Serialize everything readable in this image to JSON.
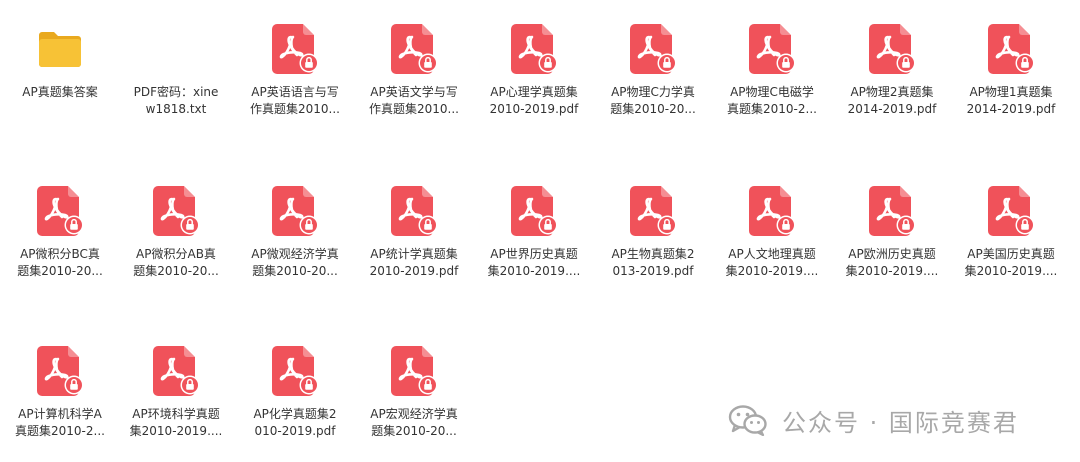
{
  "colors": {
    "pdf_icon": "#f0525a",
    "folder_icon": "#f7c236",
    "label_text": "#333333",
    "watermark": "#9a9a9a"
  },
  "files": [
    {
      "type": "folder",
      "icon": "folder-icon",
      "line1": "AP真题集答案",
      "line2": ""
    },
    {
      "type": "txt",
      "icon": "",
      "line1": "PDF密码：xine",
      "line2": "w1818.txt"
    },
    {
      "type": "pdf",
      "icon": "pdf-icon",
      "line1": "AP英语语言与写",
      "line2": "作真题集2010..."
    },
    {
      "type": "pdf",
      "icon": "pdf-icon",
      "line1": "AP英语文学与写",
      "line2": "作真题集2010..."
    },
    {
      "type": "pdf",
      "icon": "pdf-icon",
      "line1": "AP心理学真题集",
      "line2": "2010-2019.pdf"
    },
    {
      "type": "pdf",
      "icon": "pdf-icon",
      "line1": "AP物理C力学真",
      "line2": "题集2010-20..."
    },
    {
      "type": "pdf",
      "icon": "pdf-icon",
      "line1": "AP物理C电磁学",
      "line2": "真题集2010-2..."
    },
    {
      "type": "pdf",
      "icon": "pdf-icon",
      "line1": "AP物理2真题集",
      "line2": "2014-2019.pdf"
    },
    {
      "type": "pdf",
      "icon": "pdf-icon",
      "line1": "AP物理1真题集",
      "line2": "2014-2019.pdf"
    },
    {
      "type": "pdf",
      "icon": "pdf-icon",
      "line1": "AP微积分BC真",
      "line2": "题集2010-20..."
    },
    {
      "type": "pdf",
      "icon": "pdf-icon",
      "line1": "AP微积分AB真",
      "line2": "题集2010-20..."
    },
    {
      "type": "pdf",
      "icon": "pdf-icon",
      "line1": "AP微观经济学真",
      "line2": "题集2010-20..."
    },
    {
      "type": "pdf",
      "icon": "pdf-icon",
      "line1": "AP统计学真题集",
      "line2": "2010-2019.pdf"
    },
    {
      "type": "pdf",
      "icon": "pdf-icon",
      "line1": "AP世界历史真题",
      "line2": "集2010-2019...."
    },
    {
      "type": "pdf",
      "icon": "pdf-icon",
      "line1": "AP生物真题集2",
      "line2": "013-2019.pdf"
    },
    {
      "type": "pdf",
      "icon": "pdf-icon",
      "line1": "AP人文地理真题",
      "line2": "集2010-2019...."
    },
    {
      "type": "pdf",
      "icon": "pdf-icon",
      "line1": "AP欧洲历史真题",
      "line2": "集2010-2019...."
    },
    {
      "type": "pdf",
      "icon": "pdf-icon",
      "line1": "AP美国历史真题",
      "line2": "集2010-2019...."
    },
    {
      "type": "pdf",
      "icon": "pdf-icon",
      "line1": "AP计算机科学A",
      "line2": "真题集2010-2..."
    },
    {
      "type": "pdf",
      "icon": "pdf-icon",
      "line1": "AP环境科学真题",
      "line2": "集2010-2019...."
    },
    {
      "type": "pdf",
      "icon": "pdf-icon",
      "line1": "AP化学真题集2",
      "line2": "010-2019.pdf"
    },
    {
      "type": "pdf",
      "icon": "pdf-icon",
      "line1": "AP宏观经济学真",
      "line2": "题集2010-20..."
    }
  ],
  "watermark": {
    "icon": "wechat-icon",
    "text": "公众号 · 国际竞赛君"
  }
}
